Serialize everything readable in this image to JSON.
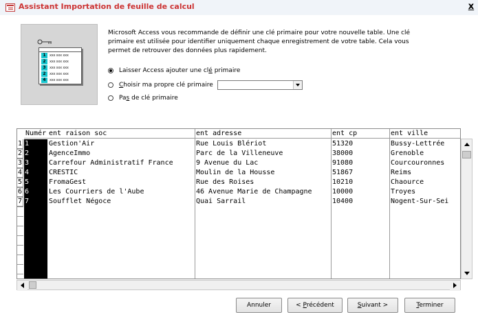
{
  "window": {
    "title": "Assistant Importation de feuille de calcul",
    "close_label": "x"
  },
  "illustration": {
    "rows": [
      {
        "num": "1",
        "text": "xxx xxx xxx"
      },
      {
        "num": "2",
        "text": "xxx xxx xxx"
      },
      {
        "num": "3",
        "text": "xxx xxx xxx"
      },
      {
        "num": "2",
        "text": "xxx xxx xxx"
      },
      {
        "num": "4",
        "text": "xxx xxx xxx"
      }
    ]
  },
  "info_text": "Microsoft Access vous recommande de définir une clé primaire pour votre nouvelle table. Une clé primaire est utilisée pour identifier uniquement chaque enregistrement de votre table.  Cela vous permet de retrouver des données plus rapidement.",
  "options": {
    "auto_pk": {
      "pre": "Laisser Access ajouter une cl",
      "accel": "é",
      "post": " primaire",
      "selected": true
    },
    "own_pk": {
      "accel": "C",
      "post": "hoisir ma propre clé primaire",
      "selected": false
    },
    "no_pk": {
      "pre": "Pa",
      "accel": "s",
      "post": " de clé primaire",
      "selected": false
    },
    "own_pk_combo_value": ""
  },
  "grid": {
    "headers": [
      "Numér",
      "ent raison soc",
      "ent adresse",
      "ent cp",
      "ent ville"
    ],
    "rows": [
      {
        "rownum": "1",
        "num": "1",
        "raison": "Gestion'Air",
        "adresse": "Rue Louis Blériot",
        "cp": "51320",
        "ville": "Bussy-Lettrée"
      },
      {
        "rownum": "2",
        "num": "2",
        "raison": "AgenceImmo",
        "adresse": "Parc de la Villeneuve",
        "cp": "38000",
        "ville": "Grenoble"
      },
      {
        "rownum": "3",
        "num": "3",
        "raison": "Carrefour Administratif France",
        "adresse": "9 Avenue du Lac",
        "cp": "91080",
        "ville": "Courcouronnes"
      },
      {
        "rownum": "4",
        "num": "4",
        "raison": "CRESTIC",
        "adresse": "Moulin de la Housse",
        "cp": "51867",
        "ville": "Reims"
      },
      {
        "rownum": "5",
        "num": "5",
        "raison": "FromaGest",
        "adresse": "Rue des Roises",
        "cp": "10210",
        "ville": "Chaource"
      },
      {
        "rownum": "6",
        "num": "6",
        "raison": "Les Courriers de l'Aube",
        "adresse": "46 Avenue Marie de Champagne",
        "cp": "10000",
        "ville": "Troyes"
      },
      {
        "rownum": "7",
        "num": "7",
        "raison": "Soufflet Négoce",
        "adresse": "Quai Sarrail",
        "cp": "10400",
        "ville": "Nogent-Sur-Sei"
      }
    ]
  },
  "buttons": {
    "cancel": "Annuler",
    "prev": {
      "pre": "< ",
      "accel": "P",
      "post": "récédent"
    },
    "next": {
      "accel": "S",
      "post": "uivant >"
    },
    "finish": {
      "accel": "T",
      "post": "erminer"
    }
  }
}
